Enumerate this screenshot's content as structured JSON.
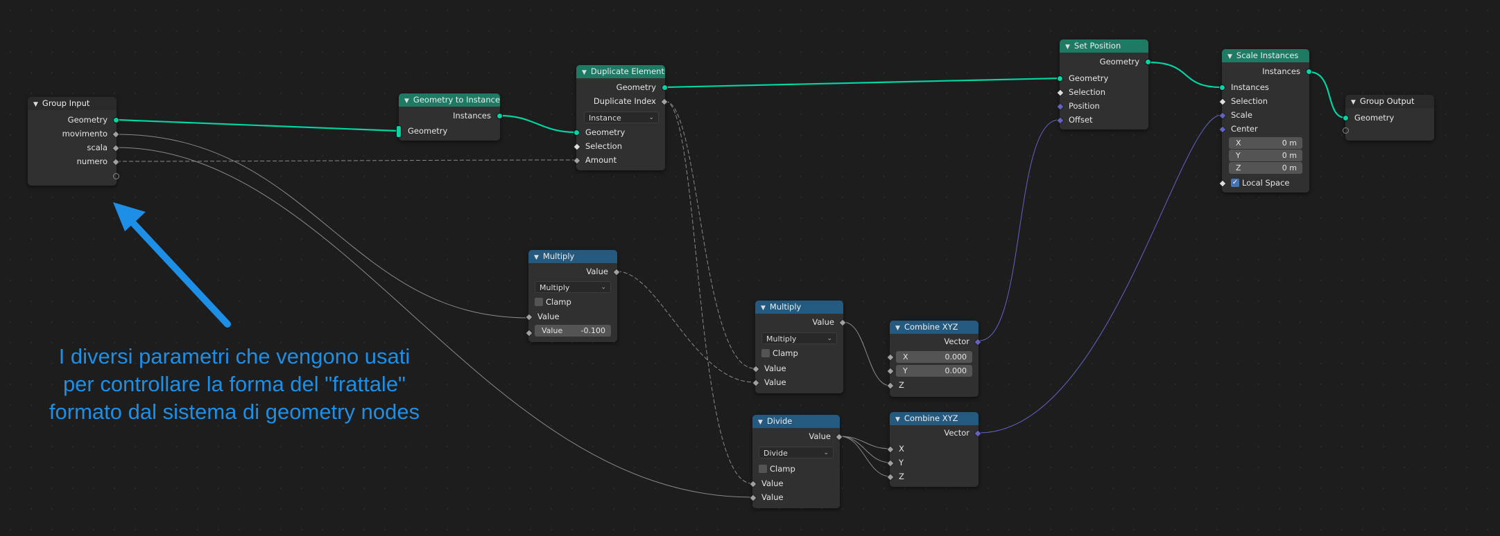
{
  "app": {
    "editor": "geometry-nodes-editor"
  },
  "colors": {
    "geometry_wire": "#00d6a3",
    "float_wire": "#a1a1a1",
    "vector_wire": "#6363c7",
    "annotation": "#1e8fe6",
    "header_green": "#1f7a63",
    "header_blue": "#245a80"
  },
  "nodes": {
    "group_input": {
      "title": "Group Input",
      "outputs": [
        "Geometry",
        "movimento",
        "scala",
        "numero"
      ]
    },
    "geo_to_instance": {
      "title": "Geometry to Instance",
      "output": "Instances",
      "input": "Geometry"
    },
    "duplicate": {
      "title": "Duplicate Elements",
      "outputs": [
        "Geometry",
        "Duplicate Index"
      ],
      "domain": "Instance",
      "inputs": [
        "Geometry",
        "Selection",
        "Amount"
      ]
    },
    "set_position": {
      "title": "Set Position",
      "output": "Geometry",
      "inputs": [
        "Geometry",
        "Selection",
        "Position",
        "Offset"
      ]
    },
    "scale_instances": {
      "title": "Scale Instances",
      "output": "Instances",
      "inputs": [
        "Instances",
        "Selection",
        "Scale",
        "Center"
      ],
      "center": [
        {
          "label": "X",
          "value": "0 m"
        },
        {
          "label": "Y",
          "value": "0 m"
        },
        {
          "label": "Z",
          "value": "0 m"
        }
      ],
      "local_space": "Local Space",
      "local_space_checked": true
    },
    "group_output": {
      "title": "Group Output",
      "input": "Geometry"
    },
    "multiply1": {
      "title": "Multiply",
      "output": "Value",
      "operation": "Multiply",
      "clamp": "Clamp",
      "input": "Value",
      "field_label": "Value",
      "field_value": "-0.100"
    },
    "multiply2": {
      "title": "Multiply",
      "output": "Value",
      "operation": "Multiply",
      "clamp": "Clamp",
      "inputs": [
        "Value",
        "Value"
      ]
    },
    "combine1": {
      "title": "Combine XYZ",
      "output": "Vector",
      "fields": [
        {
          "label": "X",
          "value": "0.000"
        },
        {
          "label": "Y",
          "value": "0.000"
        }
      ],
      "input_z": "Z"
    },
    "divide": {
      "title": "Divide",
      "output": "Value",
      "operation": "Divide",
      "clamp": "Clamp",
      "inputs": [
        "Value",
        "Value"
      ]
    },
    "combine2": {
      "title": "Combine XYZ",
      "output": "Vector",
      "inputs": [
        "X",
        "Y",
        "Z"
      ]
    }
  },
  "annotation": {
    "lines": [
      "I diversi parametri che vengono usati",
      "per controllare la forma del \"frattale\"",
      "formato dal sistema di geometry nodes"
    ]
  }
}
